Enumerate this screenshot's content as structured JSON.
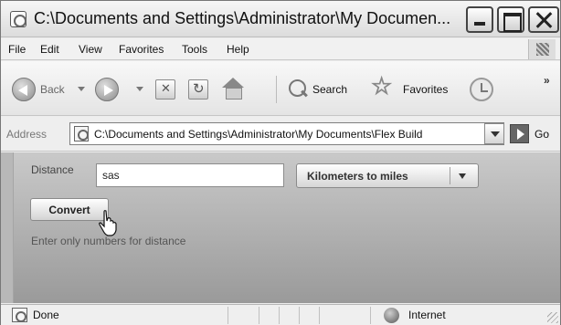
{
  "window": {
    "title": "C:\\Documents and Settings\\Administrator\\My Documen..."
  },
  "menu": {
    "items": [
      "File",
      "Edit",
      "View",
      "Favorites",
      "Tools",
      "Help"
    ]
  },
  "toolbar": {
    "back_label": "Back",
    "search_label": "Search",
    "favorites_label": "Favorites",
    "overflow": "»"
  },
  "address": {
    "label": "Address",
    "url": "C:\\Documents and Settings\\Administrator\\My Documents\\Flex Build",
    "go_label": "Go"
  },
  "form": {
    "distance_label": "Distance",
    "distance_value": "sas",
    "unit_selected": "Kilometers to miles",
    "convert_label": "Convert",
    "helper_text": "Enter only numbers for distance"
  },
  "status": {
    "text": "Done",
    "zone": "Internet"
  }
}
